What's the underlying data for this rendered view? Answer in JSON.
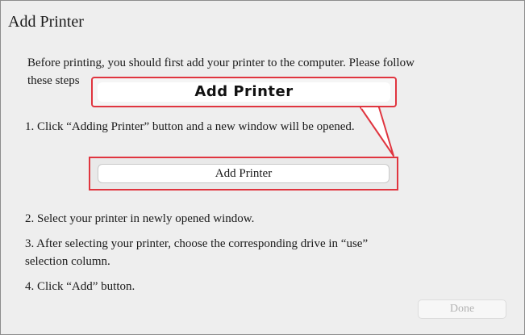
{
  "dialog": {
    "title": "Add Printer",
    "intro_line1": "Before printing, you should first add your printer to the computer. Please follow",
    "intro_line2": "these steps",
    "callout_label": "Add Printer",
    "step1": "1. Click “Adding Printer” button and a new window will be opened.",
    "add_button_label": "Add Printer",
    "step2": "2. Select your printer in newly opened window.",
    "step3_line1": "3. After selecting your printer, choose the corresponding drive in “use”",
    "step3_line2": "selection column.",
    "step4": "4. Click “Add” button.",
    "done_button_label": "Done"
  },
  "colors": {
    "highlight_red": "#e0353f",
    "dialog_background": "#eeeeee"
  }
}
